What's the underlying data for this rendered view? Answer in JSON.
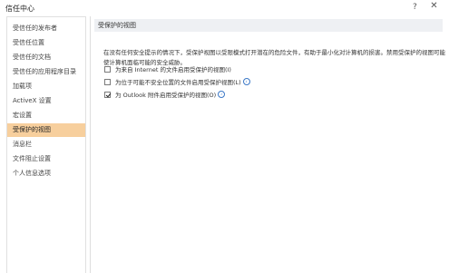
{
  "window": {
    "title": "信任中心",
    "help_glyph": "?",
    "close_glyph": "✕"
  },
  "sidebar": {
    "items": [
      {
        "label": "受信任的发布者"
      },
      {
        "label": "受信任位置"
      },
      {
        "label": "受信任的文档"
      },
      {
        "label": "受信任的应用程序目录"
      },
      {
        "label": "加载项"
      },
      {
        "label": "ActiveX 设置"
      },
      {
        "label": "宏设置"
      },
      {
        "label": "受保护的视图"
      },
      {
        "label": "消息栏"
      },
      {
        "label": "文件阻止设置"
      },
      {
        "label": "个人信息选项"
      }
    ],
    "selected_index": 7
  },
  "main": {
    "section_title": "受保护的视图",
    "description": "在没有任何安全提示的情况下，受保护视图以受限模式打开潜在的危险文件，有助于最小化对计算机的损害。禁用受保护的视图可能使计算机面临可能的安全威胁。",
    "options": [
      {
        "label": "为来自 Internet 的文件启用受保护的视图(I)",
        "checked": false,
        "info": false
      },
      {
        "label": "为位于可能不安全位置的文件启用受保护视图(L)",
        "checked": false,
        "info": true
      },
      {
        "label": "为 Outlook 附件启用受保护的视图(O)",
        "checked": true,
        "info": true
      }
    ],
    "info_glyph": "i"
  },
  "colors": {
    "selected_item_bg": "#f7cf9d",
    "section_header_bg": "#eef0f3",
    "info_icon": "#3b78c7"
  }
}
